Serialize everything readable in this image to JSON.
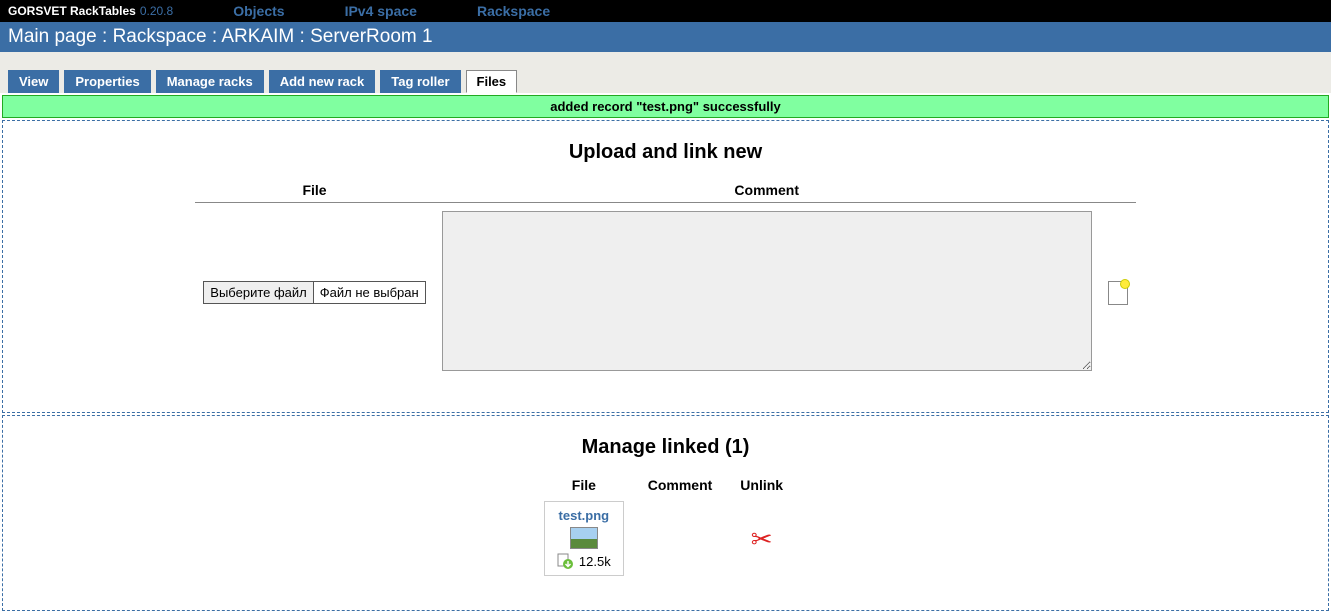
{
  "app": {
    "name": "GORSVET RackTables",
    "version": "0.20.8"
  },
  "topnav": {
    "objects": "Objects",
    "ipv4": "IPv4 space",
    "rackspace": "Rackspace"
  },
  "breadcrumb": {
    "main": "Main page",
    "rackspace": "Rackspace",
    "arkaim": "ARKAIM",
    "room": "ServerRoom 1",
    "sep": " : "
  },
  "tabs": {
    "view": "View",
    "properties": "Properties",
    "manage_racks": "Manage racks",
    "add_new_rack": "Add new rack",
    "tag_roller": "Tag roller",
    "files": "Files"
  },
  "message": "added record \"test.png\" successfully",
  "upload": {
    "title": "Upload and link new",
    "col_file": "File",
    "col_comment": "Comment",
    "choose_label": "Выберите файл",
    "no_file": "Файл не выбран"
  },
  "manage": {
    "title": "Manage linked (1)",
    "col_file": "File",
    "col_comment": "Comment",
    "col_unlink": "Unlink",
    "file_name": "test.png",
    "file_size": "12.5k"
  }
}
